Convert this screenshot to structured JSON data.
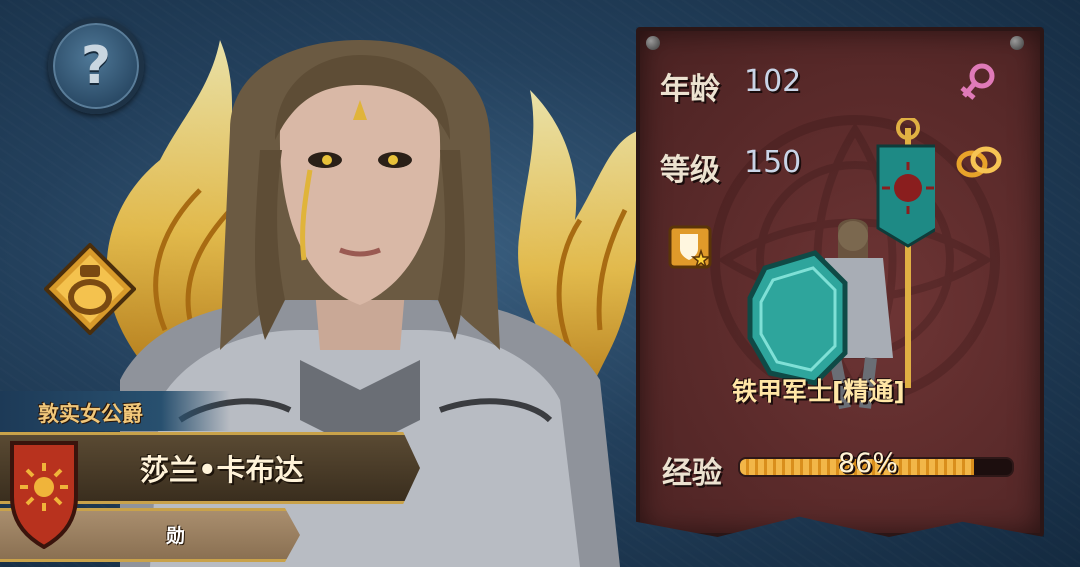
{
  "character": {
    "title": "敦实女公爵",
    "name": "莎兰•卡布达",
    "sub_label": "勋"
  },
  "stats": {
    "age_label": "年龄",
    "age_value": "102",
    "level_label": "等级",
    "level_value": "150",
    "exp_label": "经验",
    "exp_percent_text": "86%",
    "exp_fraction": 0.86
  },
  "unit": {
    "name": "铁甲军士[精通]"
  },
  "icons": {
    "help": "question-mark-icon",
    "potion": "potion-icon",
    "gender": "female-symbol-icon",
    "marriage": "wedding-rings-icon",
    "rank": "shield-star-badge-icon",
    "crest": "sun-crest-icon"
  },
  "colors": {
    "panel": "#5a2a2a",
    "exp_fill": "#f2b648",
    "name_gold": "#c9a24a",
    "gender_pink": "#e07ab8"
  }
}
